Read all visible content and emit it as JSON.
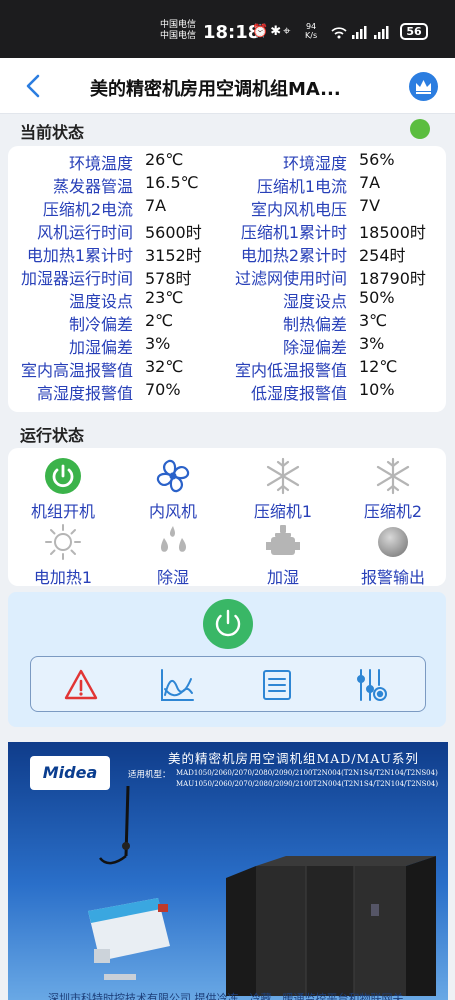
{
  "status_bar": {
    "carrier_1": "中国电信",
    "carrier_2": "中国电信",
    "time": "18:18",
    "net_speed": "94",
    "net_speed_unit": "K/s",
    "battery": "56"
  },
  "header": {
    "title": "美的精密机房用空调机组MA...",
    "back_icon": "chevron-left-icon",
    "vip_icon": "crown-icon"
  },
  "current_status": {
    "title": "当前状态",
    "indicator_color": "#5bbd3f",
    "rows": [
      {
        "l_label": "环境温度",
        "l_value": "26℃",
        "r_label": "环境湿度",
        "r_value": "56%"
      },
      {
        "l_label": "蒸发器管温",
        "l_value": "16.5℃",
        "r_label": "压缩机1电流",
        "r_value": "7A"
      },
      {
        "l_label": "压缩机2电流",
        "l_value": "7A",
        "r_label": "室内风机电压",
        "r_value": "7V"
      },
      {
        "l_label": "风机运行时间",
        "l_value": "5600时",
        "r_label": "压缩机1累计时",
        "r_value": "18500时"
      },
      {
        "l_label": "电加热1累计时",
        "l_value": "3152时",
        "r_label": "电加热2累计时",
        "r_value": "254时"
      },
      {
        "l_label": "加湿器运行时间",
        "l_value": "578时",
        "r_label": "过滤网使用时间",
        "r_value": "18790时"
      },
      {
        "l_label": "温度设点",
        "l_value": "23℃",
        "r_label": "湿度设点",
        "r_value": "50%"
      },
      {
        "l_label": "制冷偏差",
        "l_value": "2℃",
        "r_label": "制热偏差",
        "r_value": "3℃"
      },
      {
        "l_label": "加湿偏差",
        "l_value": "3%",
        "r_label": "除湿偏差",
        "r_value": "3%"
      },
      {
        "l_label": "室内高温报警值",
        "l_value": "32℃",
        "r_label": "室内低温报警值",
        "r_value": "12℃"
      },
      {
        "l_label": "高湿度报警值",
        "l_value": "70%",
        "r_label": "低湿度报警值",
        "r_value": "10%"
      }
    ]
  },
  "run_status": {
    "title": "运行状态",
    "items": [
      {
        "label": "机组开机",
        "icon": "power-icon",
        "active_color": "#3bb34a"
      },
      {
        "label": "内风机",
        "icon": "fan-icon",
        "active_color": "#2b62c9"
      },
      {
        "label": "压缩机1",
        "icon": "snowflake-icon"
      },
      {
        "label": "压缩机2",
        "icon": "snowflake-icon"
      },
      {
        "label": "电加热1",
        "icon": "sun-icon"
      },
      {
        "label": "除湿",
        "icon": "water-drops-icon"
      },
      {
        "label": "加湿",
        "icon": "humidifier-icon"
      },
      {
        "label": "报警输出",
        "icon": "alarm-ball-icon"
      }
    ]
  },
  "controls": {
    "power_icon": "power-icon",
    "power_color": "#39b766",
    "tools": [
      {
        "icon": "warning-icon",
        "color": "#e13535"
      },
      {
        "icon": "trend-chart-icon",
        "color": "#2e86d4"
      },
      {
        "icon": "list-icon",
        "color": "#2e86d4"
      },
      {
        "icon": "sliders-icon",
        "color": "#2e86d4"
      }
    ]
  },
  "banner": {
    "logo": "Midea",
    "title": "美的精密机房用空调机组MAD/MAU系列",
    "models_label": "适用机型：",
    "models_line1": "MAD1050/2060/2070/2080/2090/2100T2N004(T2N1S4/T2N104/T2NS04)",
    "models_line2": "MAU1050/2060/2070/2080/2090/2100T2N004(T2N1S4/T2N104/T2NS04)",
    "footer": "深圳市科特时控技术有限公司    提供冷冻、冷藏、暖通监控平台和物联网关"
  }
}
